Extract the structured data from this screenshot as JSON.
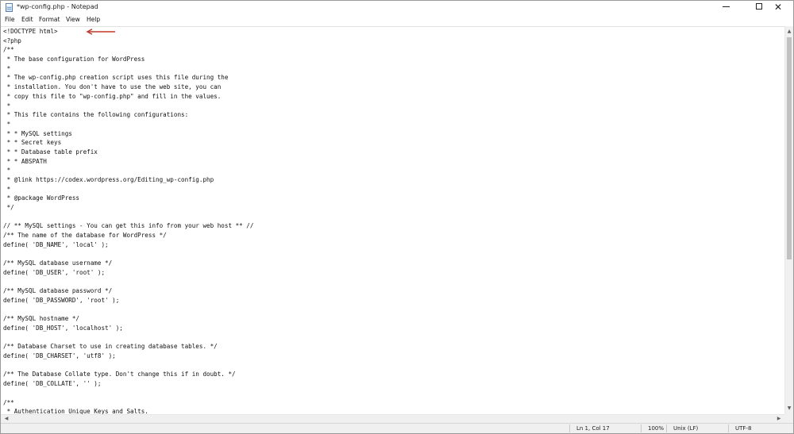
{
  "window": {
    "title": "*wp-config.php - Notepad",
    "controls": {
      "minimize": "minimize",
      "maximize": "maximize",
      "close": "✕"
    }
  },
  "menu": {
    "items": [
      {
        "label": "File"
      },
      {
        "label": "Edit"
      },
      {
        "label": "Format"
      },
      {
        "label": "View"
      },
      {
        "label": "Help"
      }
    ]
  },
  "editor": {
    "lines": [
      "<!DOCTYPE html>",
      "<?php",
      "/**",
      " * The base configuration for WordPress",
      " *",
      " * The wp-config.php creation script uses this file during the",
      " * installation. You don't have to use the web site, you can",
      " * copy this file to \"wp-config.php\" and fill in the values.",
      " *",
      " * This file contains the following configurations:",
      " *",
      " * * MySQL settings",
      " * * Secret keys",
      " * * Database table prefix",
      " * * ABSPATH",
      " *",
      " * @link https://codex.wordpress.org/Editing_wp-config.php",
      " *",
      " * @package WordPress",
      " */",
      "",
      "// ** MySQL settings - You can get this info from your web host ** //",
      "/** The name of the database for WordPress */",
      "define( 'DB_NAME', 'local' );",
      "",
      "/** MySQL database username */",
      "define( 'DB_USER', 'root' );",
      "",
      "/** MySQL database password */",
      "define( 'DB_PASSWORD', 'root' );",
      "",
      "/** MySQL hostname */",
      "define( 'DB_HOST', 'localhost' );",
      "",
      "/** Database Charset to use in creating database tables. */",
      "define( 'DB_CHARSET', 'utf8' );",
      "",
      "/** The Database Collate type. Don't change this if in doubt. */",
      "define( 'DB_COLLATE', '' );",
      "",
      "/**",
      " * Authentication Unique Keys and Salts."
    ],
    "annotation_color": "#c0392b"
  },
  "status": {
    "position": "Ln 1, Col 17",
    "zoom": "100%",
    "line_endings": "Unix (LF)",
    "encoding": "UTF-8"
  },
  "colors": {
    "background": "#ffffff",
    "chrome": "#f0f0f0",
    "text": "#111111"
  },
  "icons": [
    "notepad-icon",
    "minimize-icon",
    "maximize-icon",
    "close-icon",
    "arrow-icon",
    "scroll-up-icon",
    "scroll-down-icon",
    "scroll-left-icon",
    "scroll-right-icon"
  ]
}
